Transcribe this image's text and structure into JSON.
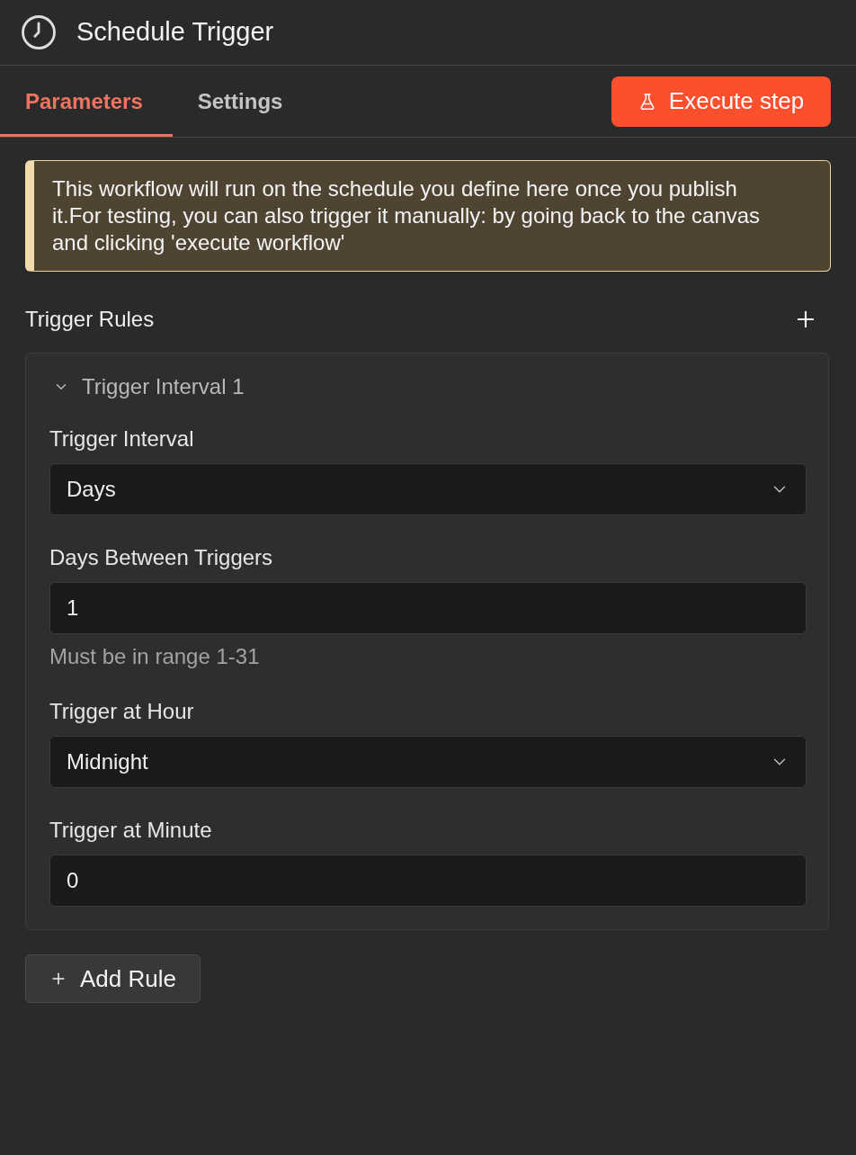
{
  "header": {
    "title": "Schedule Trigger"
  },
  "tabs": [
    {
      "label": "Parameters",
      "selected": true
    },
    {
      "label": "Settings",
      "selected": false
    }
  ],
  "execute_button": {
    "label": "Execute step"
  },
  "notice": {
    "text": "This workflow will run on the schedule you define here once you publish it.For testing, you can also trigger it manually: by going back to the canvas and clicking 'execute workflow'"
  },
  "trigger_rules": {
    "title": "Trigger Rules",
    "rules": [
      {
        "title": "Trigger Interval 1",
        "expanded": true,
        "fields": [
          {
            "kind": "select",
            "label": "Trigger Interval",
            "value": "Days"
          },
          {
            "kind": "input",
            "label": "Days Between Triggers",
            "value": "1",
            "hint": "Must be in range 1-31"
          },
          {
            "kind": "select",
            "label": "Trigger at Hour",
            "value": "Midnight"
          },
          {
            "kind": "input",
            "label": "Trigger at Minute",
            "value": "0"
          }
        ]
      }
    ]
  },
  "add_rule_button": {
    "label": "Add Rule"
  }
}
